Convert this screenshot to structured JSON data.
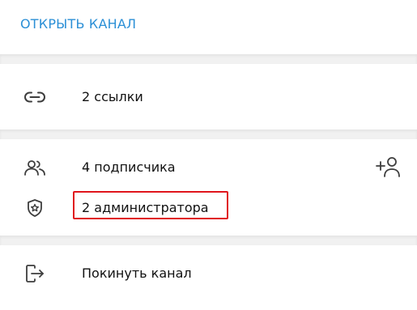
{
  "header": {
    "open_channel_label": "ОТКРЫТЬ КАНАЛ"
  },
  "links_section": {
    "links_label": "2 ссылки",
    "icon": "link-icon"
  },
  "members_section": {
    "subscribers_label": "4 подписчика",
    "subscribers_icon": "users-icon",
    "add_icon": "add-user-icon",
    "admins_label": "2 администратора",
    "admins_icon": "shield-star-icon"
  },
  "leave_section": {
    "leave_label": "Покинуть канал",
    "icon": "leave-icon"
  },
  "colors": {
    "accent": "#2b8fd6",
    "highlight_border": "#e0151c",
    "divider": "#f1f1f1",
    "icon": "#3d3d3d"
  }
}
